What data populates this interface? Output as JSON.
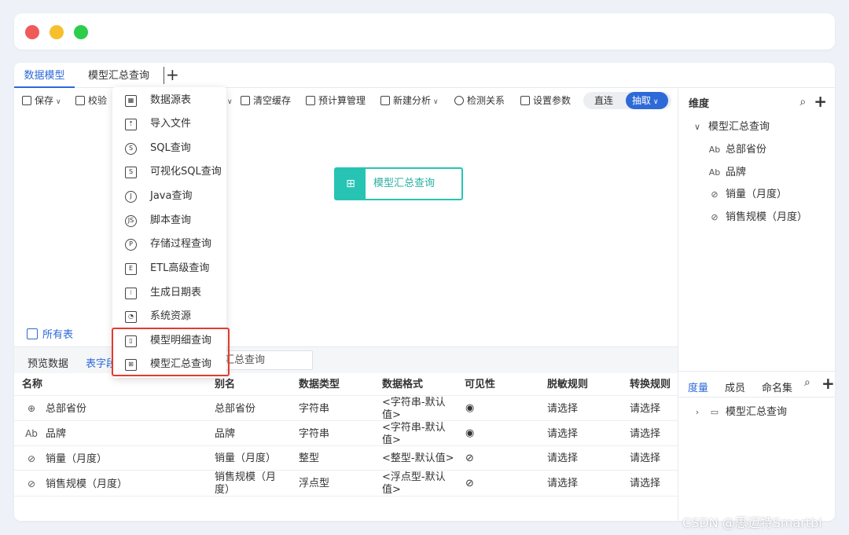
{
  "tabs": [
    "数据模型",
    "模型汇总查询"
  ],
  "tab_add": "+",
  "toolbar": {
    "save": "保存",
    "validate": "校验",
    "clear_cache": "清空缓存",
    "precompute": "预计算管理",
    "new_analysis": "新建分析",
    "detect_relations": "检测关系",
    "set_params": "设置参数",
    "mode_direct": "直连",
    "mode_extract": "抽取"
  },
  "canvas": {
    "node_label": "模型汇总查询",
    "all_tables": "所有表"
  },
  "dropdown": {
    "items": [
      "数据源表",
      "导入文件",
      "SQL查询",
      "可视化SQL查询",
      "Java查询",
      "脚本查询",
      "存储过程查询",
      "ETL高级查询",
      "生成日期表",
      "系统资源",
      "模型明细查询",
      "模型汇总查询"
    ],
    "icons": [
      "table-icon",
      "import-file-icon",
      "sql-icon",
      "visual-sql-icon",
      "java-icon",
      "script-icon",
      "procedure-icon",
      "etl-icon",
      "calendar-icon",
      "system-resource-icon",
      "model-detail-icon",
      "model-summary-icon"
    ]
  },
  "bottom_tabs": {
    "preview": "预览数据",
    "fields": "表字段",
    "search_value": "汇总查询"
  },
  "table": {
    "headers": [
      "名称",
      "别名",
      "数据类型",
      "数据格式",
      "可见性",
      "脱敏规则",
      "转换规则"
    ],
    "rows": [
      {
        "icon": "globe-icon",
        "icon_glyph": "⊕",
        "name": "总部省份",
        "alias": "总部省份",
        "type": "字符串",
        "format": "<字符串-默认值>",
        "visible": "eye-icon",
        "mask": "请选择",
        "convert": "请选择"
      },
      {
        "icon": "text-icon",
        "icon_glyph": "Ab",
        "name": "品牌",
        "alias": "品牌",
        "type": "字符串",
        "format": "<字符串-默认值>",
        "visible": "eye-icon",
        "mask": "请选择",
        "convert": "请选择"
      },
      {
        "icon": "measure-icon",
        "icon_glyph": "⊘",
        "name": "销量（月度）",
        "alias": "销量（月度）",
        "type": "整型",
        "format": "<整型-默认值>",
        "visible": "eye-off-icon",
        "mask": "请选择",
        "convert": "请选择"
      },
      {
        "icon": "measure-icon",
        "icon_glyph": "⊘",
        "name": "销售规模（月度）",
        "alias": "销售规模（月度）",
        "type": "浮点型",
        "format": "<浮点型-默认值>",
        "visible": "eye-off-icon",
        "mask": "请选择",
        "convert": "请选择"
      }
    ]
  },
  "dimension_panel": {
    "title": "维度",
    "tree_root": "模型汇总查询",
    "items": [
      {
        "icon": "Ab",
        "label": "总部省份"
      },
      {
        "icon": "Ab",
        "label": "品牌"
      },
      {
        "icon": "⊘",
        "label": "销量（月度）"
      },
      {
        "icon": "⊘",
        "label": "销售规模（月度）"
      }
    ]
  },
  "measure_panel": {
    "tabs": [
      "度量",
      "成员",
      "命名集"
    ],
    "tree_root": "模型汇总查询"
  },
  "watermark": "CSDN @思迈特Smartbi",
  "colors": {
    "accent": "#2d6ad8",
    "node": "#27c4b4",
    "highlight": "#e23b2f"
  }
}
